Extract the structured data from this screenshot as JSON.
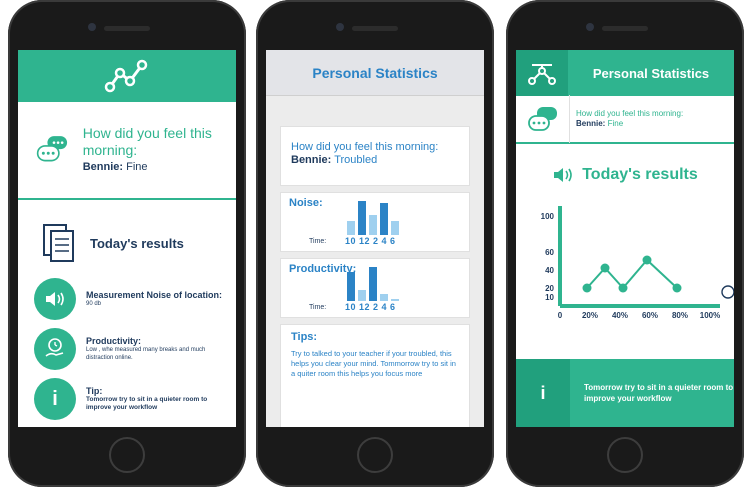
{
  "phone1": {
    "question": "How did you feel this morning:",
    "user": "Bennie:",
    "mood": "Fine",
    "results_title": "Today's results",
    "items": [
      {
        "title": "Measurement Noise of location:",
        "sub": "90 db"
      },
      {
        "title": "Productivity:",
        "sub": "Low , whe measured many breaks and much distraction online."
      },
      {
        "title": "Tip:",
        "sub": "Tomorrow try to sit in a quieter room to improve your workflow"
      }
    ],
    "info_glyph": "i"
  },
  "phone2": {
    "title": "Personal Statistics",
    "question": "How did you feel this morning:",
    "user": "Bennie:",
    "mood": "Troubled",
    "noise_label": "Noise:",
    "productivity_label": "Productivity:",
    "time_label": "Time:",
    "ticks": "10 12 2 4 6",
    "noise_bars": [
      0.4,
      0.95,
      0.55,
      0.9,
      0.4
    ],
    "productivity_bars": [
      0.8,
      0.3,
      0.95,
      0.2,
      0.05
    ],
    "tips_label": "Tips:",
    "tips_body": "Try to talked to your teacher if your troubled, this helps you clear your mind. Tommorrow try to sit in a quiter room this helps you focus more"
  },
  "phone3": {
    "title": "Personal Statistics",
    "question": "How did you feel this morning:",
    "user": "Bennie:",
    "mood": "Fine",
    "results_title": "Today's results",
    "tip": "Tomorrow try to sit in a quieter room to improve your workflow",
    "info_glyph": "i"
  },
  "colors": {
    "teal": "#2fb48f",
    "teal_dark": "#21a07d",
    "navy": "#1f3a5c",
    "blue": "#2b83c6"
  },
  "chart_data": {
    "type": "line",
    "x": [
      "20%",
      "40%",
      "60%",
      "80%"
    ],
    "points": [
      {
        "x": 18,
        "y": 18
      },
      {
        "x": 30,
        "y": 38
      },
      {
        "x": 42,
        "y": 18
      },
      {
        "x": 58,
        "y": 46
      },
      {
        "x": 78,
        "y": 18
      }
    ],
    "y_ticks": [
      "100",
      "60",
      "40",
      "20",
      "10"
    ],
    "x_ticks": [
      "0",
      "20%",
      "40%",
      "60%",
      "80%",
      "100%"
    ],
    "ylim": [
      0,
      100
    ]
  }
}
